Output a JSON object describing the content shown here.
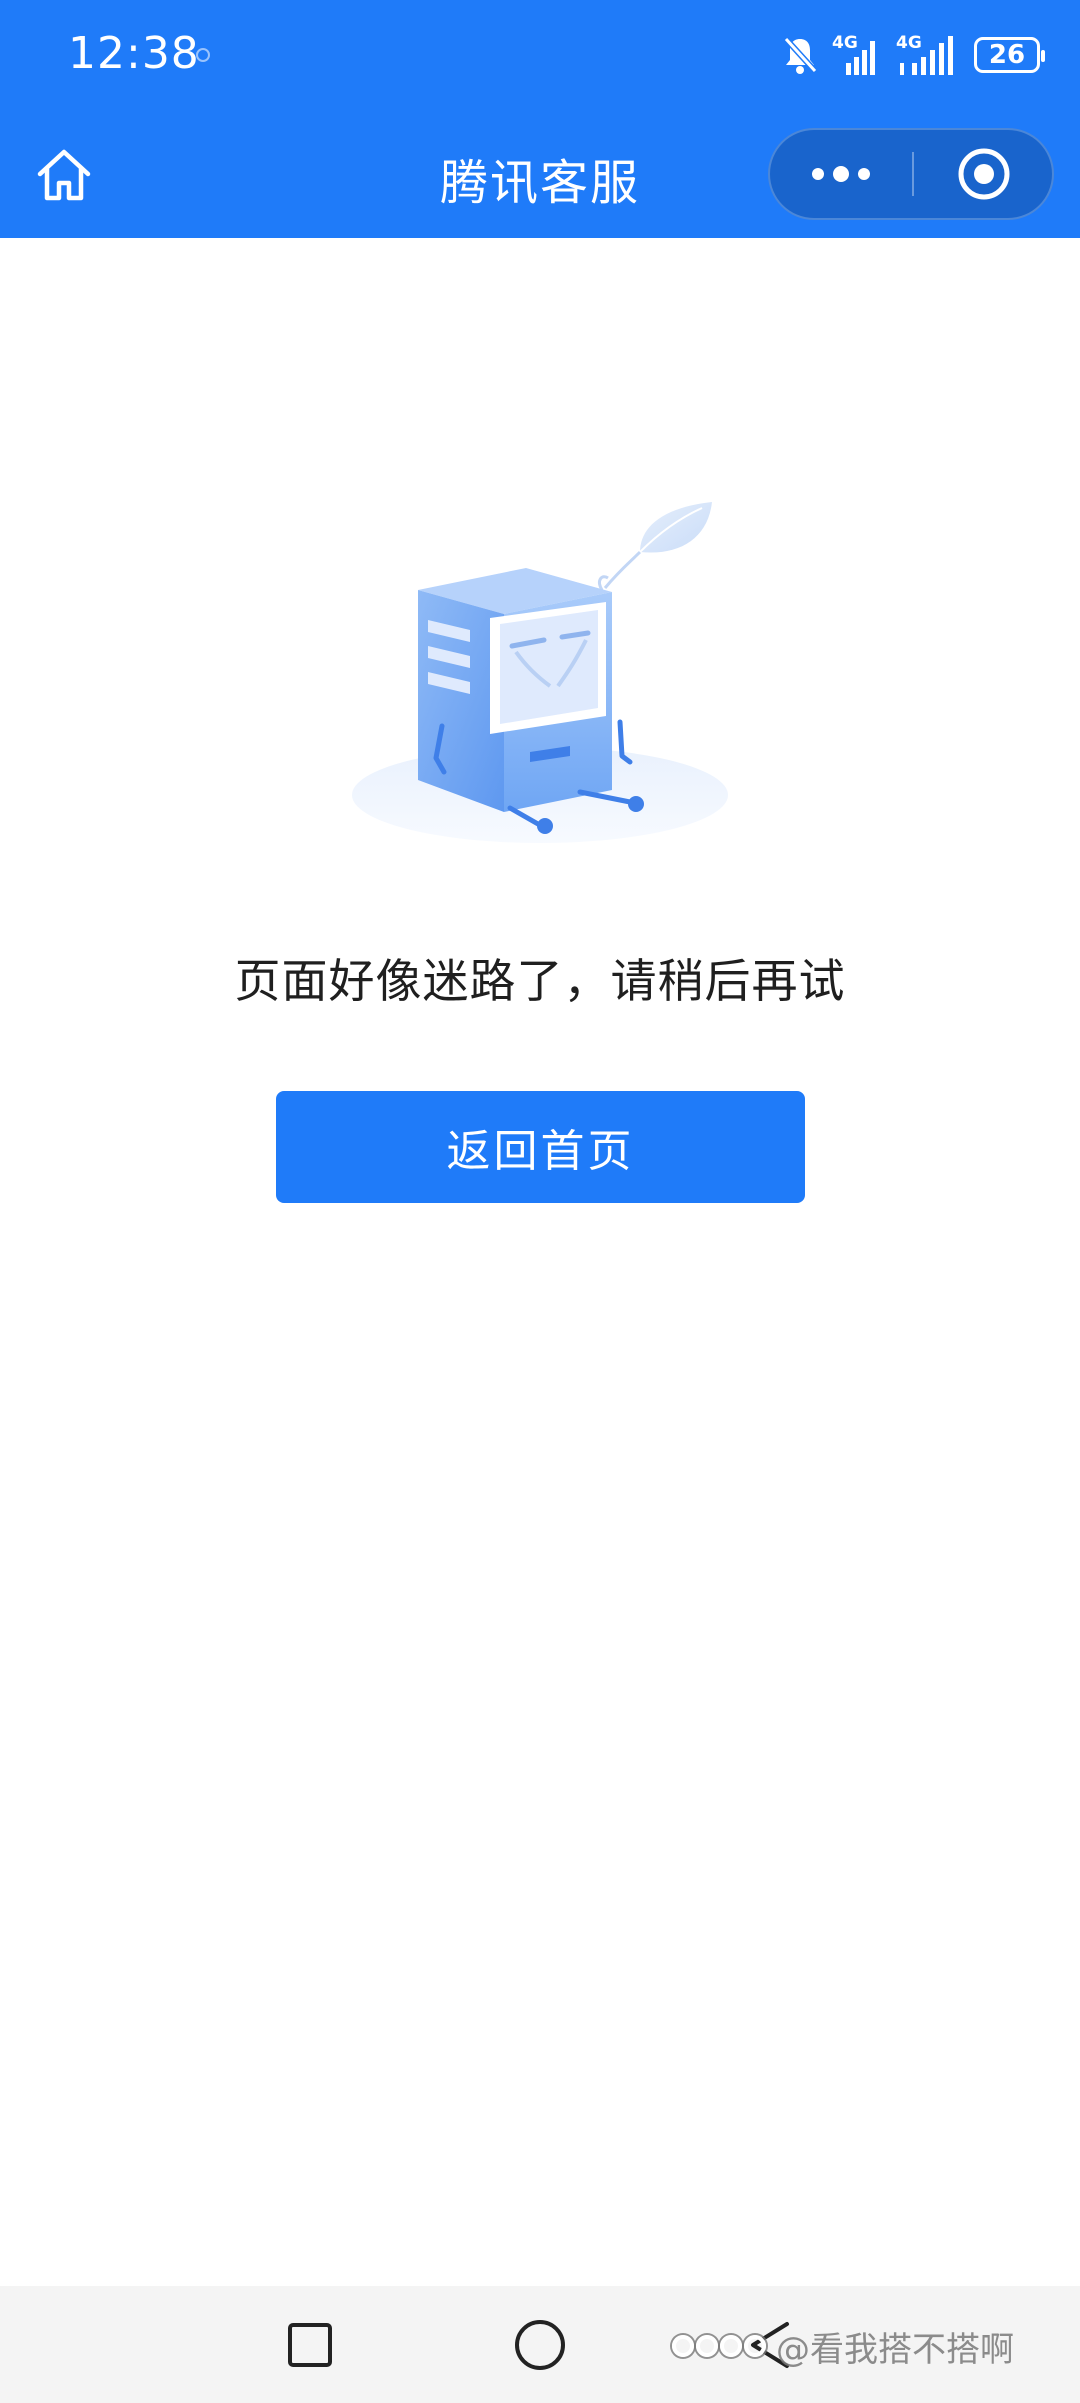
{
  "status_bar": {
    "time": "12:38",
    "network_1": "4G",
    "network_2": "4G",
    "battery": "26"
  },
  "header": {
    "title": "腾讯客服"
  },
  "main": {
    "message": "页面好像迷路了，请稍后再试",
    "home_button_label": "返回首页"
  },
  "watermark": {
    "text": "@看我搭不搭啊"
  },
  "colors": {
    "primary": "#1f7bf9",
    "text": "#1f1f1f",
    "nav_background": "#f4f4f4"
  },
  "icons": {
    "home": "home-icon",
    "more": "more-dots-icon",
    "close": "target-close-icon",
    "recent": "square-icon",
    "home_sys": "circle-icon",
    "back": "triangle-back-icon",
    "mute": "bell-off-icon"
  }
}
